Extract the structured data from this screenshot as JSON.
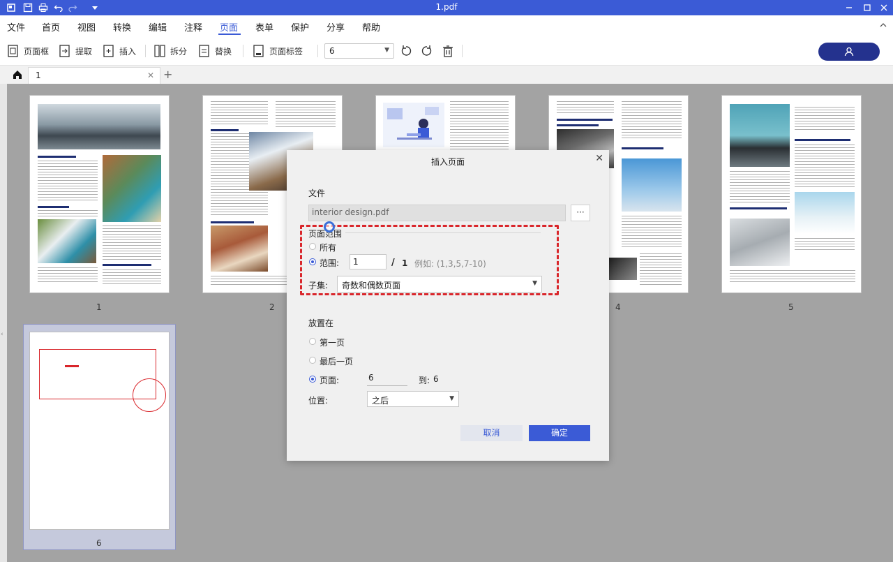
{
  "app": {
    "title": "1.pdf",
    "accent": "#3b5bd6"
  },
  "menu": {
    "items": [
      "文件",
      "首页",
      "视图",
      "转换",
      "编辑",
      "注释",
      "页面",
      "表单",
      "保护",
      "分享",
      "帮助"
    ],
    "active": "页面"
  },
  "toolbar": {
    "page_frame": "页面框",
    "extract": "提取",
    "insert": "插入",
    "split": "拆分",
    "replace": "替换",
    "page_label": "页面标签",
    "page_select": "6"
  },
  "tabs": {
    "doc_tab": "1"
  },
  "thumbnails": {
    "labels": [
      "1",
      "2",
      "4",
      "5",
      "6"
    ]
  },
  "dialog": {
    "title": "插入页面",
    "file_section": "文件",
    "file_value": "interior design.pdf",
    "browse_label": "···",
    "page_range_label": "页面范围",
    "all_label": "所有",
    "range_label": "范围:",
    "range_value": "1",
    "range_of": "/",
    "range_total": "1",
    "example": "例如: (1,3,5,7-10)",
    "subset_label": "子集:",
    "subset_value": "奇数和偶数页面",
    "place_section": "放置在",
    "first_page": "第一页",
    "last_page": "最后一页",
    "page_label": "页面:",
    "page_value": "6",
    "to_label": "到:",
    "to_value": "6",
    "position_label": "位置:",
    "position_value": "之后",
    "cancel": "取消",
    "ok": "确定"
  }
}
